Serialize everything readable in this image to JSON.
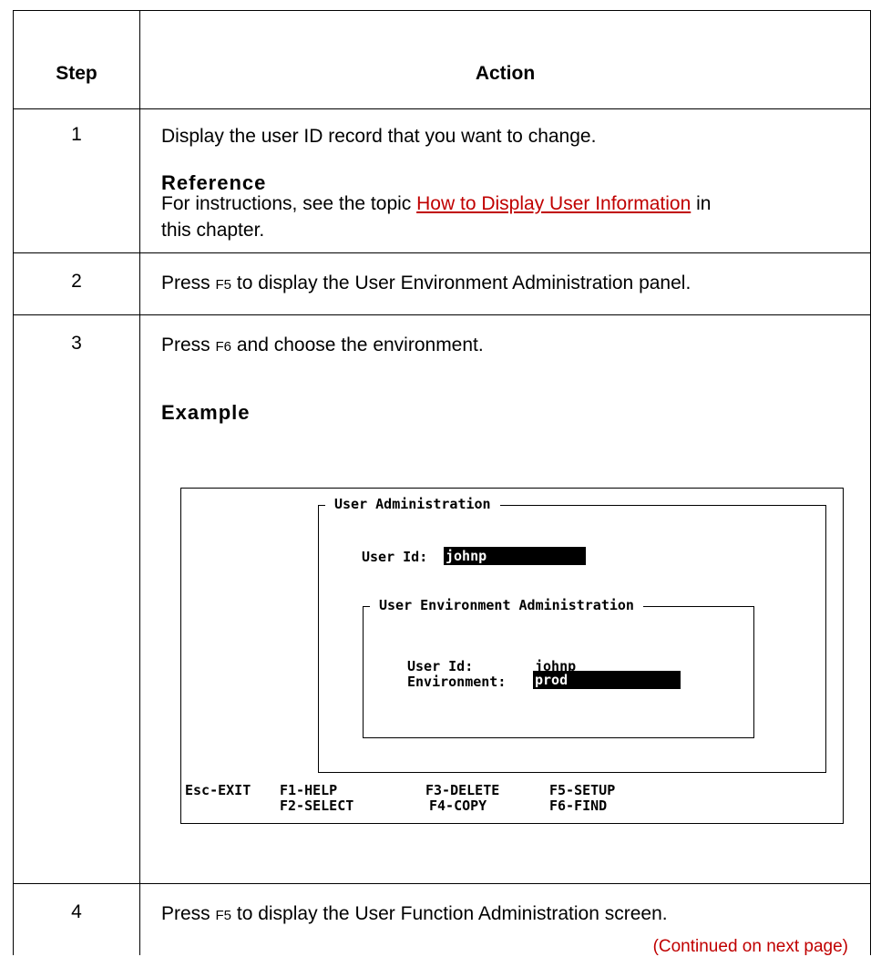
{
  "table": {
    "headers": {
      "step": "Step",
      "action": "Action"
    },
    "rows": [
      {
        "step": "1",
        "text": "Display the user ID record that you want to change.",
        "reference_heading": "Reference",
        "reference_pre": "For instructions, see the topic ",
        "reference_link": "How to Display User Information",
        "reference_post": " in",
        "reference_line2": "this chapter."
      },
      {
        "step": "2",
        "text_pre": "Press ",
        "key": "F5",
        "text_post": " to display the User Environment Administration panel."
      },
      {
        "step": "3",
        "text_pre": "Press ",
        "key": "F6",
        "text_post": " and choose the environment.",
        "example_heading": "Example"
      },
      {
        "step": "4",
        "text_pre": "Press ",
        "key": "F5",
        "text_post": " to display the User Function Administration screen."
      }
    ],
    "continued": "(Continued on next page)"
  },
  "screen": {
    "outer_title": "User Administration",
    "user_id_label": "User Id:",
    "user_id_value": "johnp",
    "inner_title": "User Environment Administration",
    "inner_user_id_label": "User Id:",
    "inner_user_id_value": "johnp",
    "environment_label": "Environment:",
    "environment_value": "prod",
    "fkeys": {
      "esc": "Esc-EXIT",
      "f1": "F1-HELP",
      "f2": "F2-SELECT",
      "f3": "F3-DELETE",
      "f4": "F4-COPY",
      "f5": "F5-SETUP",
      "f6": "F6-FIND"
    }
  }
}
